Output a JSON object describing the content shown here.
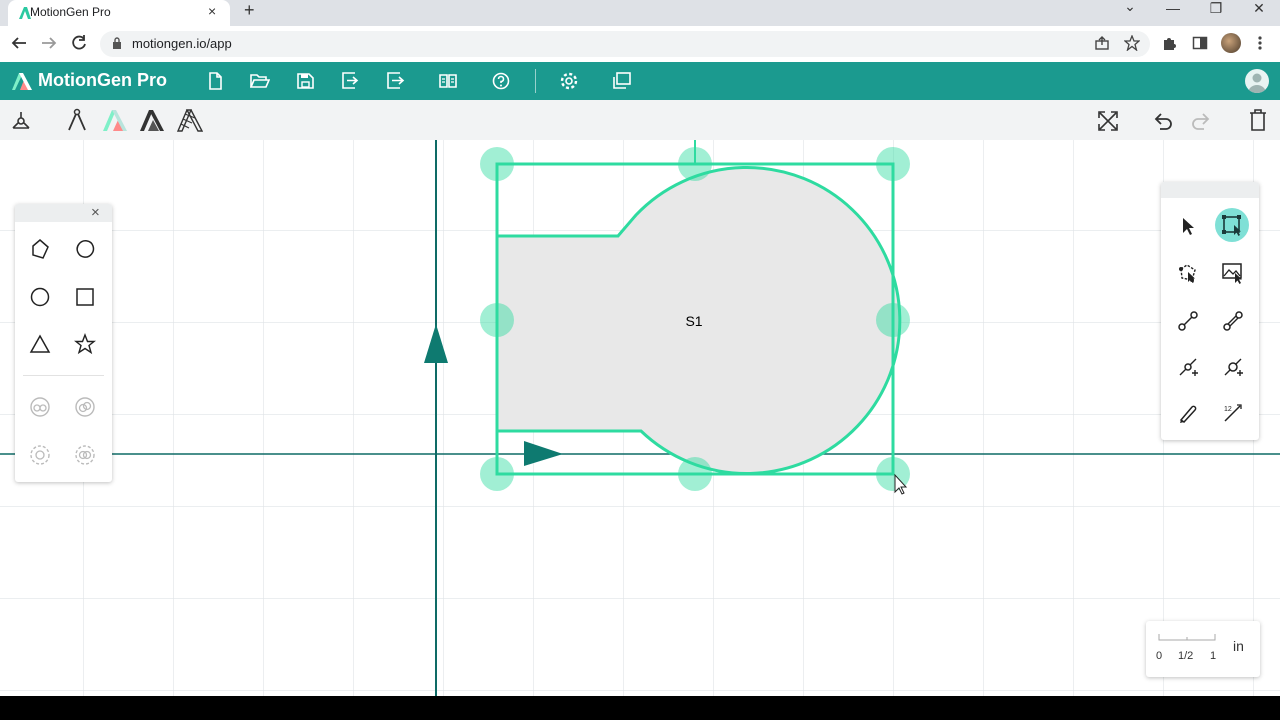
{
  "browser": {
    "tab_title": "MotionGen Pro",
    "tab_close": "×",
    "new_tab": "+",
    "url": "motiongen.io/app",
    "window_controls": {
      "dropdown": "⌄",
      "minimize": "—",
      "restore": "❐",
      "close": "✕"
    }
  },
  "app": {
    "brand": "MotionGen Pro",
    "header_icons": [
      "new-file-icon",
      "open-folder-icon",
      "save-icon",
      "import-icon",
      "export-icon",
      "library-icon",
      "help-icon",
      "settings-icon",
      "gallery-icon"
    ],
    "toolbar_left_icons": [
      "linkage-icon",
      "drafting-icon",
      "motiongen-a-icon",
      "motiongen-a-dark-icon",
      "motiongen-a-hatched-icon"
    ],
    "toolbar_right_icons": [
      "fit-screen-icon",
      "undo-icon",
      "redo-icon",
      "trash-icon"
    ]
  },
  "shape_panel": {
    "close": "×",
    "tools": [
      "polygon-icon",
      "blob-icon",
      "circle-icon",
      "square-icon",
      "triangle-icon",
      "star-icon",
      "union-icon",
      "subtract-icon",
      "intersect-icon",
      "exclude-icon"
    ]
  },
  "tool_panel": {
    "tools": [
      "pointer-icon",
      "select-box-icon",
      "edit-shape-icon",
      "image-select-icon",
      "link-icon",
      "link-alt-icon",
      "add-joint-icon",
      "add-joint-alt-icon",
      "pen-icon",
      "dimension-icon"
    ],
    "active_tool": "select-box-icon"
  },
  "canvas": {
    "shape_label": "S1",
    "accent": "#2edba0",
    "axis_color": "#0e6b66"
  },
  "scale": {
    "ticks": [
      "0",
      "1/2",
      "1"
    ],
    "unit": "in"
  }
}
